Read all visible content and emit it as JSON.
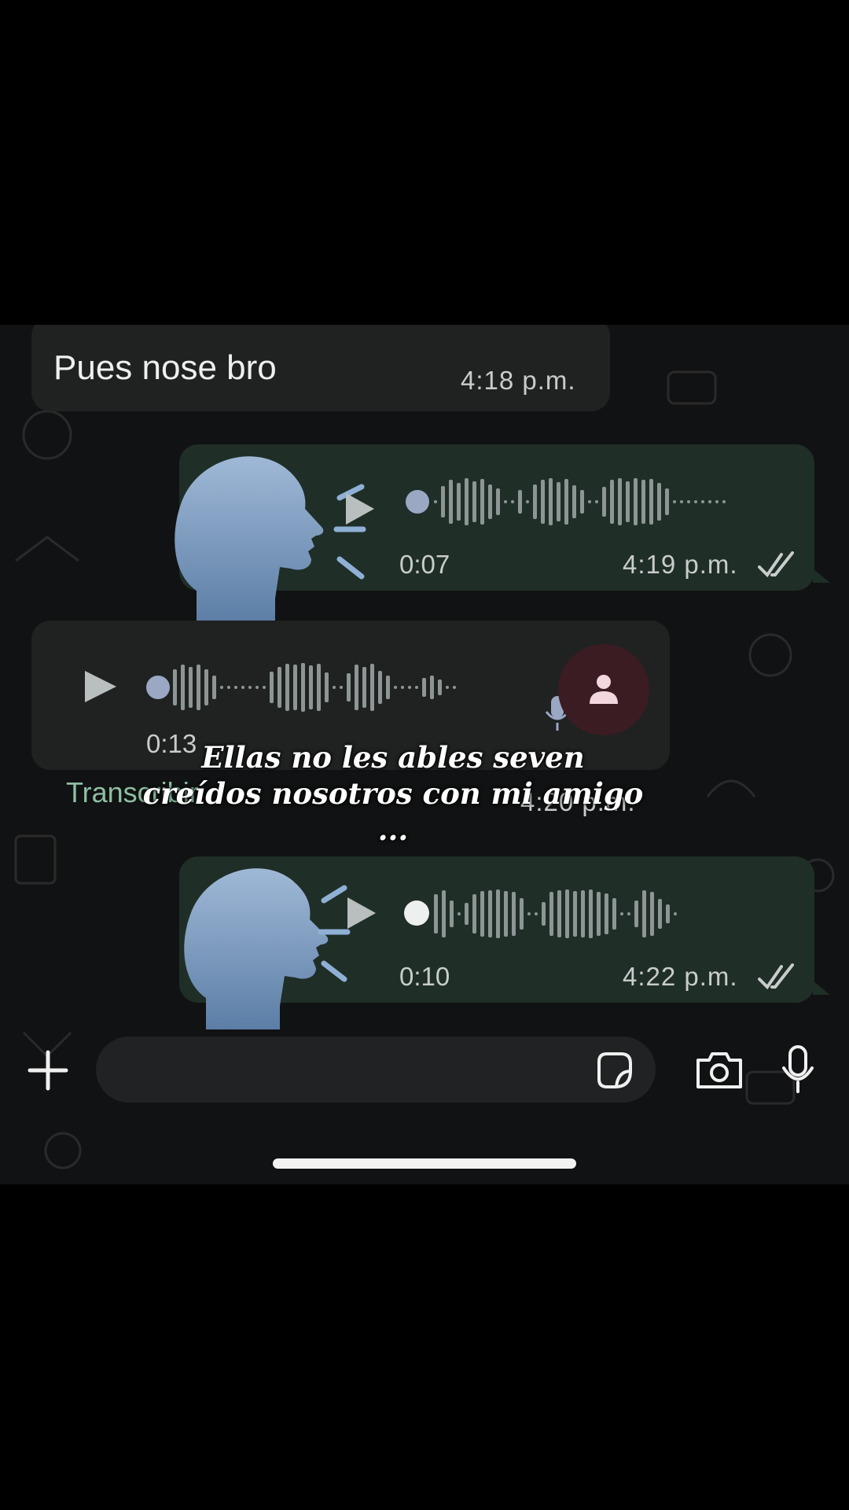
{
  "messages": [
    {
      "direction": "incoming",
      "type": "text",
      "text": "Pues nose bro",
      "time": "4:18 p.m."
    },
    {
      "direction": "outgoing",
      "type": "voice",
      "duration": "0:07",
      "time": "4:19 p.m.",
      "status_icon": "double-check-icon"
    },
    {
      "direction": "incoming",
      "type": "voice",
      "duration": "0:13",
      "time": "4:20 p.m.",
      "action": "Transcribir",
      "avatar_icon": "person-icon"
    },
    {
      "direction": "outgoing",
      "type": "voice",
      "duration": "0:10",
      "time": "4:22 p.m.",
      "status_icon": "double-check-icon"
    }
  ],
  "overlay_caption": "Ellas no les ables seven creídos nosotros con mi amigo ...",
  "input_bar": {
    "attach_icon": "plus-icon",
    "sticker_icon": "sticker-icon",
    "camera_icon": "camera-icon",
    "mic_icon": "microphone-icon"
  },
  "emoji": "speaking-head-emoji",
  "colors": {
    "outgoing_bubble": "#1f2e27",
    "incoming_bubble": "#202222",
    "accent_green": "#8fbfa3",
    "voice_knob": "#9aa8c4"
  }
}
